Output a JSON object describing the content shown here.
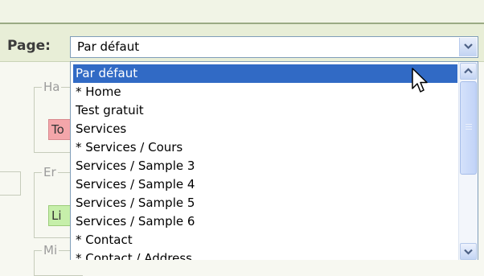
{
  "page_selector": {
    "label": "Page:",
    "selected_value": "Par défaut",
    "options": [
      "Par défaut",
      "* Home",
      "Test gratuit",
      "Services",
      "* Services / Cours",
      "Services / Sample 3",
      "Services / Sample 4",
      "Services / Sample 5",
      "Services / Sample 6",
      "* Contact",
      "* Contact / Address"
    ],
    "highlighted_index": 0
  },
  "background_form": {
    "legend_1": "Ha",
    "legend_2": "Er",
    "legend_3": "Mi",
    "button_1": "To",
    "button_2": "Li"
  },
  "icons": {
    "dropdown_arrow": "chevron-down-icon",
    "scroll_up": "chevron-up-icon",
    "scroll_down": "chevron-down-icon",
    "pointer": "mouse-pointer-icon"
  },
  "colors": {
    "selection": "#316ac5",
    "button_pink": "#f4a6aa",
    "button_green": "#c6efaa"
  }
}
